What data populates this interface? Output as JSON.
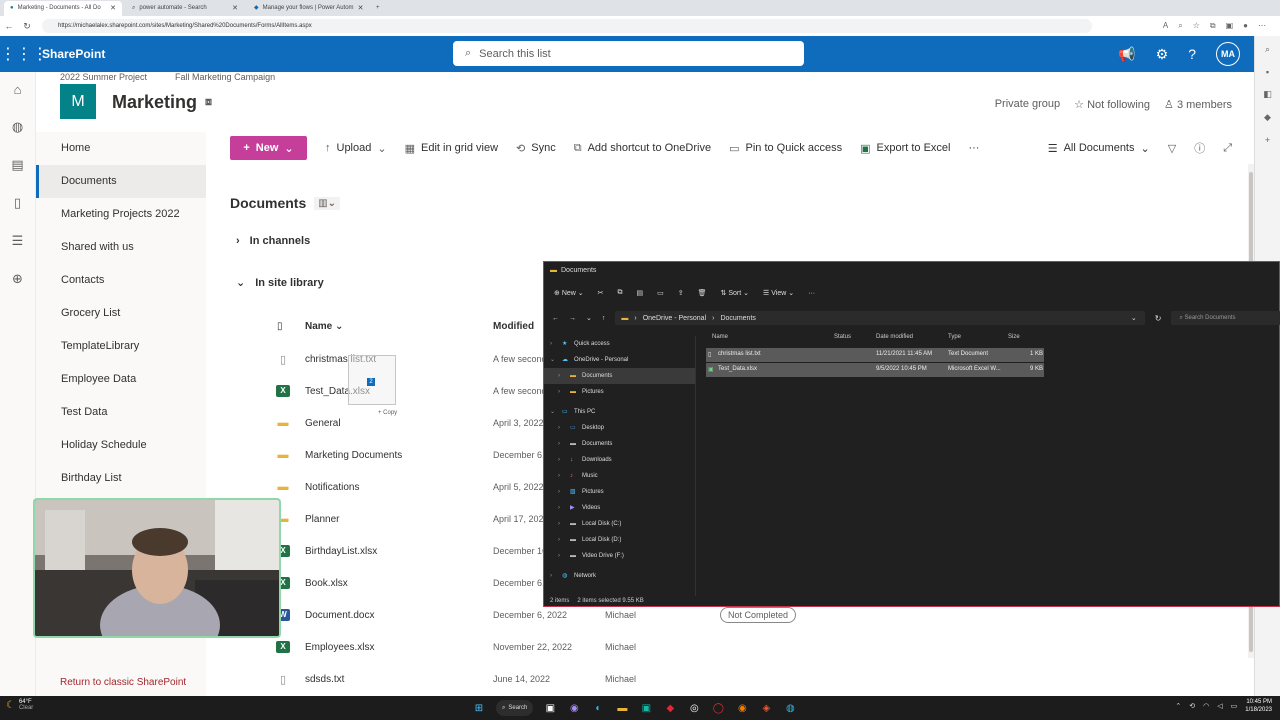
{
  "browser": {
    "tabs": [
      {
        "label": "Marketing - Documents - All Do",
        "active": true
      },
      {
        "label": "power automate - Search",
        "active": false
      },
      {
        "label": "Manage your flows | Power Autom",
        "active": false
      }
    ],
    "url": "https://michaelalex.sharepoint.com/sites/Marketing/Shared%20Documents/Forms/AllItems.aspx"
  },
  "suite": {
    "brand": "SharePoint",
    "search_placeholder": "Search this list",
    "avatar": "MA"
  },
  "site": {
    "hub_links": [
      "2022 Summer Project",
      "Fall Marketing Campaign"
    ],
    "logo_letter": "M",
    "title": "Marketing",
    "privacy": "Private group",
    "follow": "Not following",
    "members": "3 members"
  },
  "leftnav": {
    "items": [
      {
        "label": "Home",
        "selected": false
      },
      {
        "label": "Documents",
        "selected": true
      },
      {
        "label": "Marketing Projects 2022",
        "selected": false
      },
      {
        "label": "Shared with us",
        "selected": false
      },
      {
        "label": "Contacts",
        "selected": false
      },
      {
        "label": "Grocery List",
        "selected": false
      },
      {
        "label": "TemplateLibrary",
        "selected": false
      },
      {
        "label": "Employee Data",
        "selected": false
      },
      {
        "label": "Test Data",
        "selected": false
      },
      {
        "label": "Holiday Schedule",
        "selected": false
      },
      {
        "label": "Birthday List",
        "selected": false
      }
    ],
    "return_classic": "Return to classic SharePoint"
  },
  "commandbar": {
    "new": "New",
    "upload": "Upload",
    "edit_grid": "Edit in grid view",
    "sync": "Sync",
    "add_shortcut": "Add shortcut to OneDrive",
    "pin": "Pin to Quick access",
    "export": "Export to Excel",
    "more": "···",
    "view": "All Documents"
  },
  "library": {
    "title": "Documents",
    "sections": [
      "In channels",
      "In site library"
    ],
    "columns": {
      "name": "Name",
      "modified": "Modified"
    },
    "rows": [
      {
        "name": "christmas list.txt",
        "type": "txt",
        "modified": "A few seconds ago",
        "by": "",
        "status": ""
      },
      {
        "name": "Test_Data.xlsx",
        "type": "xlsx",
        "modified": "A few seconds ago",
        "by": "",
        "status": ""
      },
      {
        "name": "General",
        "type": "folder",
        "modified": "April 3, 2022",
        "by": "",
        "status": ""
      },
      {
        "name": "Marketing Documents",
        "type": "folder",
        "modified": "December 6, 2022",
        "by": "",
        "status": ""
      },
      {
        "name": "Notifications",
        "type": "folder",
        "modified": "April 5, 2022",
        "by": "",
        "status": ""
      },
      {
        "name": "Planner",
        "type": "folder",
        "modified": "April 17, 2022",
        "by": "",
        "status": ""
      },
      {
        "name": "BirthdayList.xlsx",
        "type": "xlsx",
        "modified": "December 16, 2022",
        "by": "",
        "status": ""
      },
      {
        "name": "Book.xlsx",
        "type": "xlsx",
        "modified": "December 6, 2022",
        "by": "",
        "status": ""
      },
      {
        "name": "Document.docx",
        "type": "docx",
        "modified": "December 6, 2022",
        "by": "Michael",
        "status": "Not Completed"
      },
      {
        "name": "Employees.xlsx",
        "type": "xlsx",
        "modified": "November 22, 2022",
        "by": "Michael",
        "status": ""
      },
      {
        "name": "sdsds.txt",
        "type": "txt",
        "modified": "June 14, 2022",
        "by": "Michael",
        "status": ""
      }
    ],
    "drag_count": "2",
    "drag_hint": "+ Copy"
  },
  "explorer": {
    "title": "Documents",
    "toolbar": {
      "new": "New",
      "sort": "Sort",
      "view": "View",
      "more": "···"
    },
    "path": [
      "OneDrive - Personal",
      "Documents"
    ],
    "search_placeholder": "Search Documents",
    "nav": [
      {
        "label": "Quick access",
        "chevron": "›",
        "icon": "★"
      },
      {
        "label": "OneDrive - Personal",
        "chevron": "⌄",
        "icon": "☁"
      },
      {
        "label": "Documents",
        "chevron": "›",
        "icon": "▬",
        "selected": true
      },
      {
        "label": "Pictures",
        "chevron": "›",
        "icon": "▬"
      },
      {
        "label": "This PC",
        "chevron": "⌄",
        "icon": "▭"
      },
      {
        "label": "Desktop",
        "chevron": "›",
        "icon": "▭"
      },
      {
        "label": "Documents",
        "chevron": "›",
        "icon": "▬"
      },
      {
        "label": "Downloads",
        "chevron": "›",
        "icon": "↓"
      },
      {
        "label": "Music",
        "chevron": "›",
        "icon": "♪"
      },
      {
        "label": "Pictures",
        "chevron": "›",
        "icon": "▧"
      },
      {
        "label": "Videos",
        "chevron": "›",
        "icon": "▶"
      },
      {
        "label": "Local Disk (C:)",
        "chevron": "›",
        "icon": "▬"
      },
      {
        "label": "Local Disk (D:)",
        "chevron": "›",
        "icon": "▬"
      },
      {
        "label": "Video Drive (F:)",
        "chevron": "›",
        "icon": "▬"
      },
      {
        "label": "Network",
        "chevron": "›",
        "icon": "◍"
      }
    ],
    "columns": {
      "name": "Name",
      "status": "Status",
      "date": "Date modified",
      "type": "Type",
      "size": "Size"
    },
    "files": [
      {
        "name": "christmas list.txt",
        "date": "11/21/2021 11:45 AM",
        "type": "Text Document",
        "size": "1 KB"
      },
      {
        "name": "Test_Data.xlsx",
        "date": "9/5/2022 10:45 PM",
        "type": "Microsoft Excel W...",
        "size": "9 KB"
      }
    ],
    "status": {
      "items": "2 items",
      "selected": "2 items selected  9.55 KB"
    }
  },
  "taskbar": {
    "weather_temp": "64°F",
    "weather_desc": "Clear",
    "search": "Search",
    "time": "10:45 PM",
    "date": "1/18/2023"
  }
}
